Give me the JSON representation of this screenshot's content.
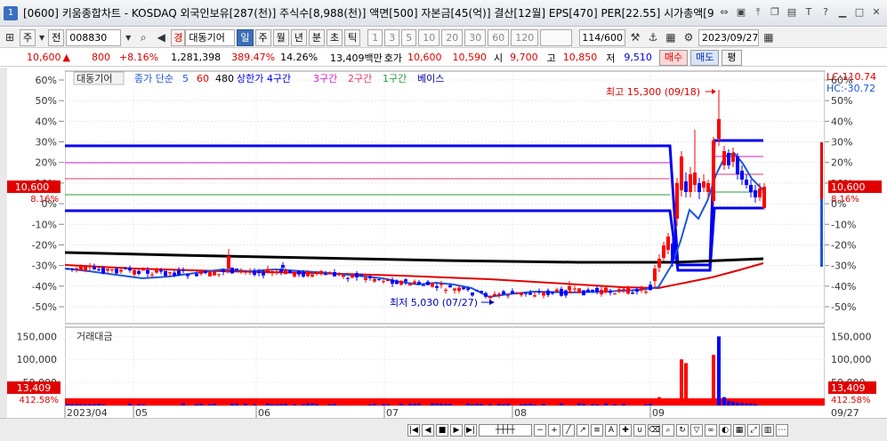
{
  "window": {
    "number": "1",
    "title": "[0600] 키움종합차트 - KOSDAQ 외국인보유[287(천)] 주식수[8,988(천)] 액면[500] 자본금[45(억)] 결산[12월] EPS[470] PER[22.55] 시가총액[9"
  },
  "toolbar": {
    "type_label": "주",
    "prev_label": "전",
    "code": "008830",
    "name_tag": "경",
    "name": "대동기어",
    "periods": [
      "일",
      "주",
      "월",
      "년",
      "분",
      "초",
      "틱"
    ],
    "active_period": "일",
    "intervals": [
      "1",
      "3",
      "5",
      "10",
      "20",
      "30",
      "60",
      "120"
    ],
    "count": "114",
    "count_total": "/600",
    "date": "2023/09/27"
  },
  "pricebar": {
    "price": "10,600",
    "change": "800",
    "change_pct": "+8.16%",
    "volume": "1,281,398",
    "vol_ratio": "389.47%",
    "turnover": "14.26%",
    "amount": "13,409백만",
    "quote_label": "호가",
    "quote": "10,600",
    "quote2": "10,590",
    "open_label": "시",
    "open": "9,700",
    "high_label": "고",
    "high": "10,850",
    "low_label": "저",
    "low": "9,510",
    "buy_label": "매수",
    "sell_label": "매도",
    "eval_label": "평"
  },
  "legend": {
    "name": "대동기어",
    "ma_label": "종가 단순",
    "ma5": "5",
    "ma60": "60",
    "ma480": "480",
    "limit_label": "상한가 4구간",
    "zone3": "3구간",
    "zone2": "2구간",
    "zone1": "1구간",
    "base": "베이스",
    "lc": "LC:110.74",
    "hc": "HC:-30.72"
  },
  "annotations": {
    "high": "최고 15,300 (09/18)",
    "low": "최저 5,030 (07/27)"
  },
  "price_axis": [
    "60%",
    "50%",
    "40%",
    "30%",
    "20%",
    "10%",
    "0%",
    "-10%",
    "-20%",
    "-30%",
    "-40%",
    "-50%"
  ],
  "current_tag": {
    "price": "10,600",
    "pct": "8.16%"
  },
  "volume_panel": {
    "title": "거래대금",
    "axis": [
      "150,000",
      "100,000",
      "50,000"
    ],
    "tag_value": "13,409",
    "tag_pct": "412.58%"
  },
  "x_axis": [
    "2023/04",
    "05",
    "06",
    "07",
    "08",
    "09"
  ],
  "x_axis_right": "09/27",
  "colors": {
    "up": "#ff0000",
    "down": "#0000ff",
    "ma5": "#1e55d8",
    "ma60": "#e00000",
    "ma480": "#000000",
    "zone_outer": "#0000ee",
    "zone3": "#cc22cc",
    "zone2": "#e03a6a",
    "zone1": "#2a9a3a"
  },
  "icons": [
    "settings-icon",
    "minimize-icon",
    "maximize-icon",
    "close-icon",
    "help-icon"
  ]
}
